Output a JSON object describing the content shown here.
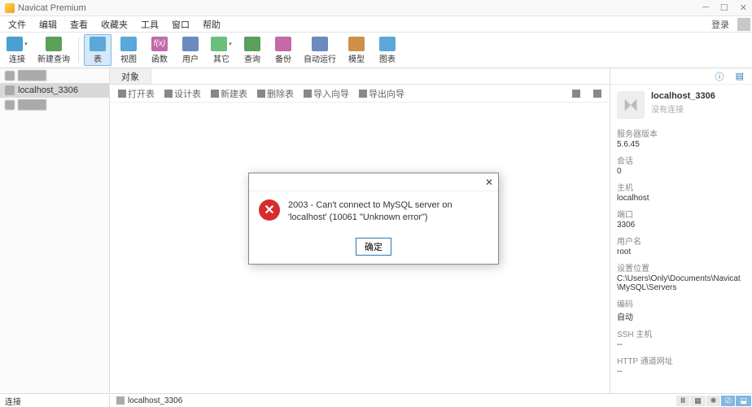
{
  "app": {
    "title": "Navicat Premium"
  },
  "menu": {
    "items": [
      "文件",
      "编辑",
      "查看",
      "收藏夹",
      "工具",
      "窗口",
      "帮助"
    ],
    "login": "登录"
  },
  "toolbar": {
    "items": [
      {
        "label": "连接",
        "icon": "#4aa0d0",
        "arrow": true
      },
      {
        "label": "新建查询",
        "icon": "#5aa05a"
      }
    ],
    "objects": [
      {
        "label": "表",
        "icon": "#5aa8d8",
        "active": true
      },
      {
        "label": "视图",
        "icon": "#5aa8d8"
      },
      {
        "label": "函数",
        "icon": "#c46aa8",
        "fx": true
      },
      {
        "label": "用户",
        "icon": "#6a8ac0"
      },
      {
        "label": "其它",
        "icon": "#6ac07a",
        "arrow": true
      },
      {
        "label": "查询",
        "icon": "#5aa05a"
      },
      {
        "label": "备份",
        "icon": "#c46aa8"
      },
      {
        "label": "自动运行",
        "icon": "#6a8ac0"
      },
      {
        "label": "模型",
        "icon": "#d0904a"
      },
      {
        "label": "图表",
        "icon": "#5aa8d8"
      }
    ]
  },
  "sidebar": {
    "items": [
      {
        "label": "",
        "blur": true
      },
      {
        "label": "localhost_3306",
        "selected": true
      },
      {
        "label": "",
        "blur": true
      }
    ]
  },
  "tabs": {
    "main": "对象"
  },
  "subtoolbar": {
    "items": [
      "打开表",
      "设计表",
      "新建表",
      "删除表",
      "导入向导",
      "导出向导"
    ]
  },
  "right": {
    "name": "localhost_3306",
    "sub": "没有连接",
    "props": [
      {
        "k": "服务器版本",
        "v": "5.6.45"
      },
      {
        "k": "会话",
        "v": "0"
      },
      {
        "k": "主机",
        "v": "localhost"
      },
      {
        "k": "端口",
        "v": "3306"
      },
      {
        "k": "用户名",
        "v": "root"
      },
      {
        "k": "设置位置",
        "v": "C:\\Users\\Only\\Documents\\Navicat\\MySQL\\Servers"
      },
      {
        "k": "编码",
        "v": "自动"
      },
      {
        "k": "SSH 主机",
        "v": "--"
      },
      {
        "k": "HTTP 通道网址",
        "v": "--"
      }
    ]
  },
  "dialog": {
    "message": "2003 - Can't connect to MySQL server on 'localhost' (10061 \"Unknown error\")",
    "ok": "确定"
  },
  "status": {
    "left": "连接",
    "mid": "localhost_3306"
  }
}
